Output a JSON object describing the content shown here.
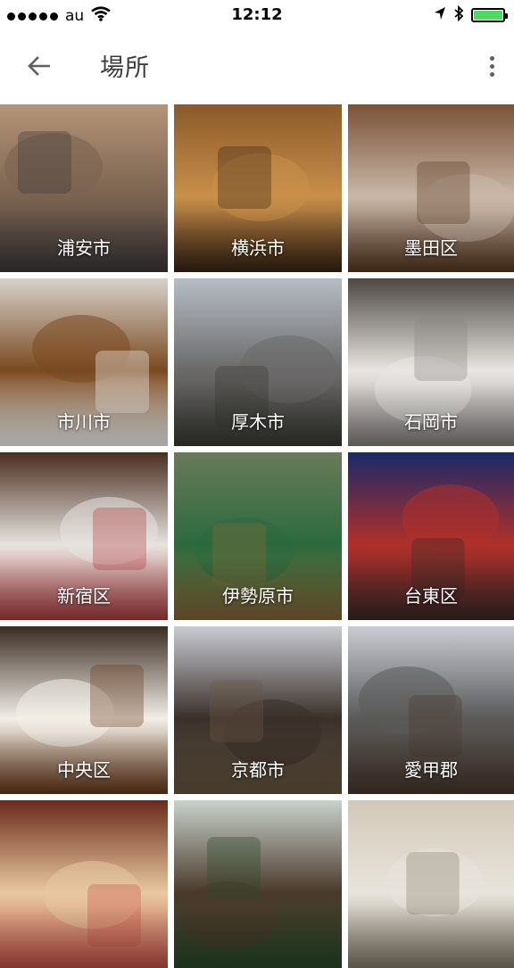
{
  "status_bar": {
    "carrier": "au",
    "time": "12:12"
  },
  "app_bar": {
    "title": "場所"
  },
  "places": [
    {
      "label": "浦安市",
      "colors": [
        "#b59478",
        "#7a6350",
        "#3d3a3c"
      ]
    },
    {
      "label": "横浜市",
      "colors": [
        "#8a5a2a",
        "#c98f4a",
        "#3a2414"
      ]
    },
    {
      "label": "墨田区",
      "colors": [
        "#7a5238",
        "#c9b8a8",
        "#5a3a22"
      ]
    },
    {
      "label": "市川市",
      "colors": [
        "#d7d2cc",
        "#7a4a20",
        "#ffffff"
      ]
    },
    {
      "label": "厚木市",
      "colors": [
        "#b7bdc6",
        "#6b6a6a",
        "#3a3a34"
      ]
    },
    {
      "label": "石岡市",
      "colors": [
        "#4d4844",
        "#e8e6e2",
        "#8a8684"
      ]
    },
    {
      "label": "新宿区",
      "colors": [
        "#4a2e20",
        "#e6e3e0",
        "#b23c40"
      ]
    },
    {
      "label": "伊勢原市",
      "colors": [
        "#6a7a5a",
        "#2c6a3e",
        "#8a6a3a"
      ]
    },
    {
      "label": "台東区",
      "colors": [
        "#1a2a6a",
        "#b0302a",
        "#3a2a28"
      ]
    },
    {
      "label": "中央区",
      "colors": [
        "#3a2c22",
        "#f2efe8",
        "#6a3a1a"
      ]
    },
    {
      "label": "京都市",
      "colors": [
        "#c9ccd2",
        "#3a302a",
        "#6a5a44"
      ]
    },
    {
      "label": "愛甲郡",
      "colors": [
        "#c9ccd2",
        "#5a5a5a",
        "#4a3a2e"
      ]
    },
    {
      "label": "",
      "colors": [
        "#6a2a1a",
        "#e8c8a0",
        "#c9544a"
      ]
    },
    {
      "label": "",
      "colors": [
        "#c8d2cc",
        "#4a3a2c",
        "#2a4a2a"
      ]
    },
    {
      "label": "",
      "colors": [
        "#d2c8b8",
        "#e8e4dc",
        "#8a8070"
      ]
    }
  ]
}
